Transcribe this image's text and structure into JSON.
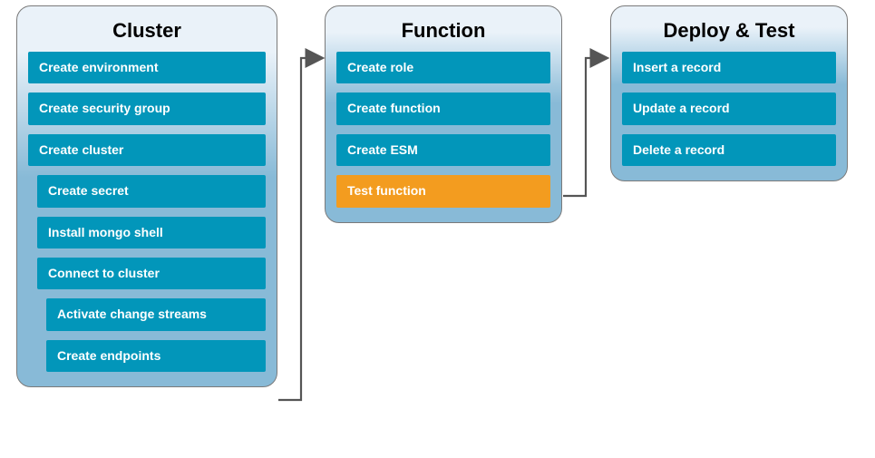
{
  "panels": [
    {
      "title": "Cluster",
      "items": [
        {
          "label": "Create environment",
          "indent": 0
        },
        {
          "label": "Create security group",
          "indent": 0
        },
        {
          "label": "Create cluster",
          "indent": 0
        },
        {
          "label": "Create secret",
          "indent": 1
        },
        {
          "label": "Install mongo shell",
          "indent": 1
        },
        {
          "label": "Connect to cluster",
          "indent": 1
        },
        {
          "label": "Activate change streams",
          "indent": 2
        },
        {
          "label": "Create endpoints",
          "indent": 2
        }
      ]
    },
    {
      "title": "Function",
      "items": [
        {
          "label": "Create role",
          "indent": 0
        },
        {
          "label": "Create function",
          "indent": 0
        },
        {
          "label": "Create ESM",
          "indent": 0
        },
        {
          "label": "Test function",
          "indent": 0,
          "highlight": true
        }
      ]
    },
    {
      "title": "Deploy & Test",
      "items": [
        {
          "label": "Insert a record",
          "indent": 0
        },
        {
          "label": "Update a record",
          "indent": 0
        },
        {
          "label": "Delete a record",
          "indent": 0
        }
      ]
    }
  ],
  "colors": {
    "step": "#0296ba",
    "highlight": "#f39c1f",
    "panel_top": "#eaf2f9",
    "panel_bottom": "#88bad7",
    "arrow": "#555555"
  }
}
